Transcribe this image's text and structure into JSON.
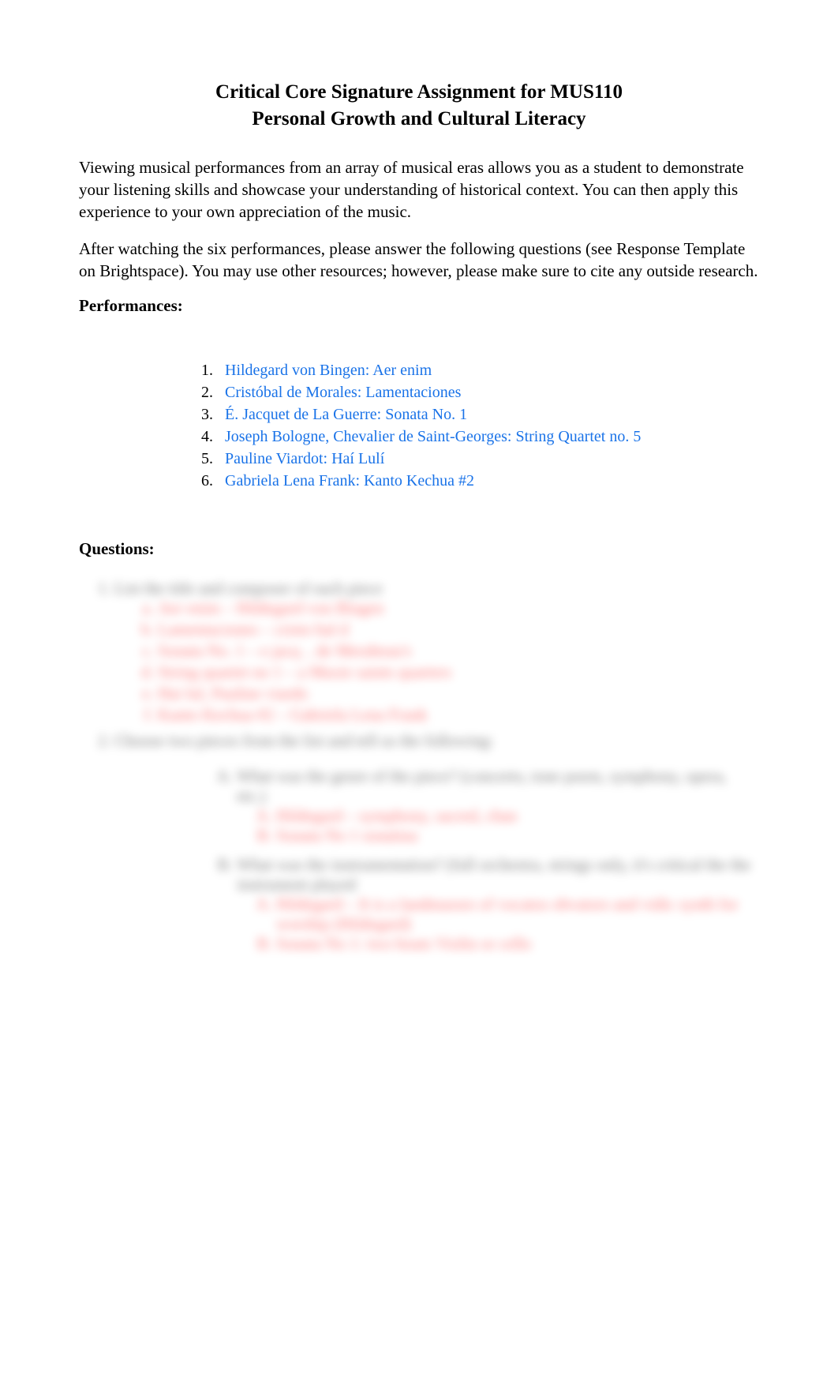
{
  "title": {
    "line1": "Critical Core Signature Assignment for MUS110",
    "line2": "Personal Growth and Cultural Literacy"
  },
  "intro": {
    "p1": "Viewing musical performances from an array of musical eras allows you as a student to demonstrate your listening skills and showcase your understanding of historical context. You can then apply this experience to your own appreciation of the music.",
    "p2": "After watching the six performances, please answer the following questions (see Response Template on Brightspace). You may use other resources; however, please make sure to cite any outside research."
  },
  "performances_heading": "Performances:",
  "performances": [
    "Hildegard von Bingen: Aer enim",
    "Cristóbal de Morales: Lamentaciones",
    "É. Jacquet de La Guerre: Sonata No. 1",
    "Joseph Bologne, Chevalier de Saint-Georges: String Quartet no. 5",
    "Pauline Viardot: Haí Lulí",
    "Gabriela Lena Frank: Kanto Kechua #2"
  ],
  "questions_heading": "Questions:",
  "q1": {
    "prompt": "List the title and composer of each piece",
    "answers": [
      "Aer enim – Hildegard von Bingen",
      "Lamentaciones – cristo bal d",
      "Sonata No. 1 – e jacq .. de Merabeau's",
      "String quartet no 1 – a Maxie saints quarters",
      "Hai lul, Pauline viardo",
      "Kanto Kechua #2 – Gabriela Lena Frank"
    ]
  },
  "q2": {
    "prompt": "Choose two pieces from the list and tell us the following:",
    "sub": [
      {
        "q": "What was the genre of the piece? (concerto, tone poem, symphony, opera, etc.)",
        "ans": [
          "Hildegard – symphony, sacred, chan",
          "Sonata No 1 sonatina"
        ]
      },
      {
        "q": "What was the instrumentation? (full orchestra, strings only, it's critical the the instrument played",
        "ans": [
          "Hildegard – It is a landmasses of vocatos obvators and vidic synth for worship (Hildegard)",
          "Sonata No 1: two bouts Violin or cello"
        ]
      }
    ]
  }
}
